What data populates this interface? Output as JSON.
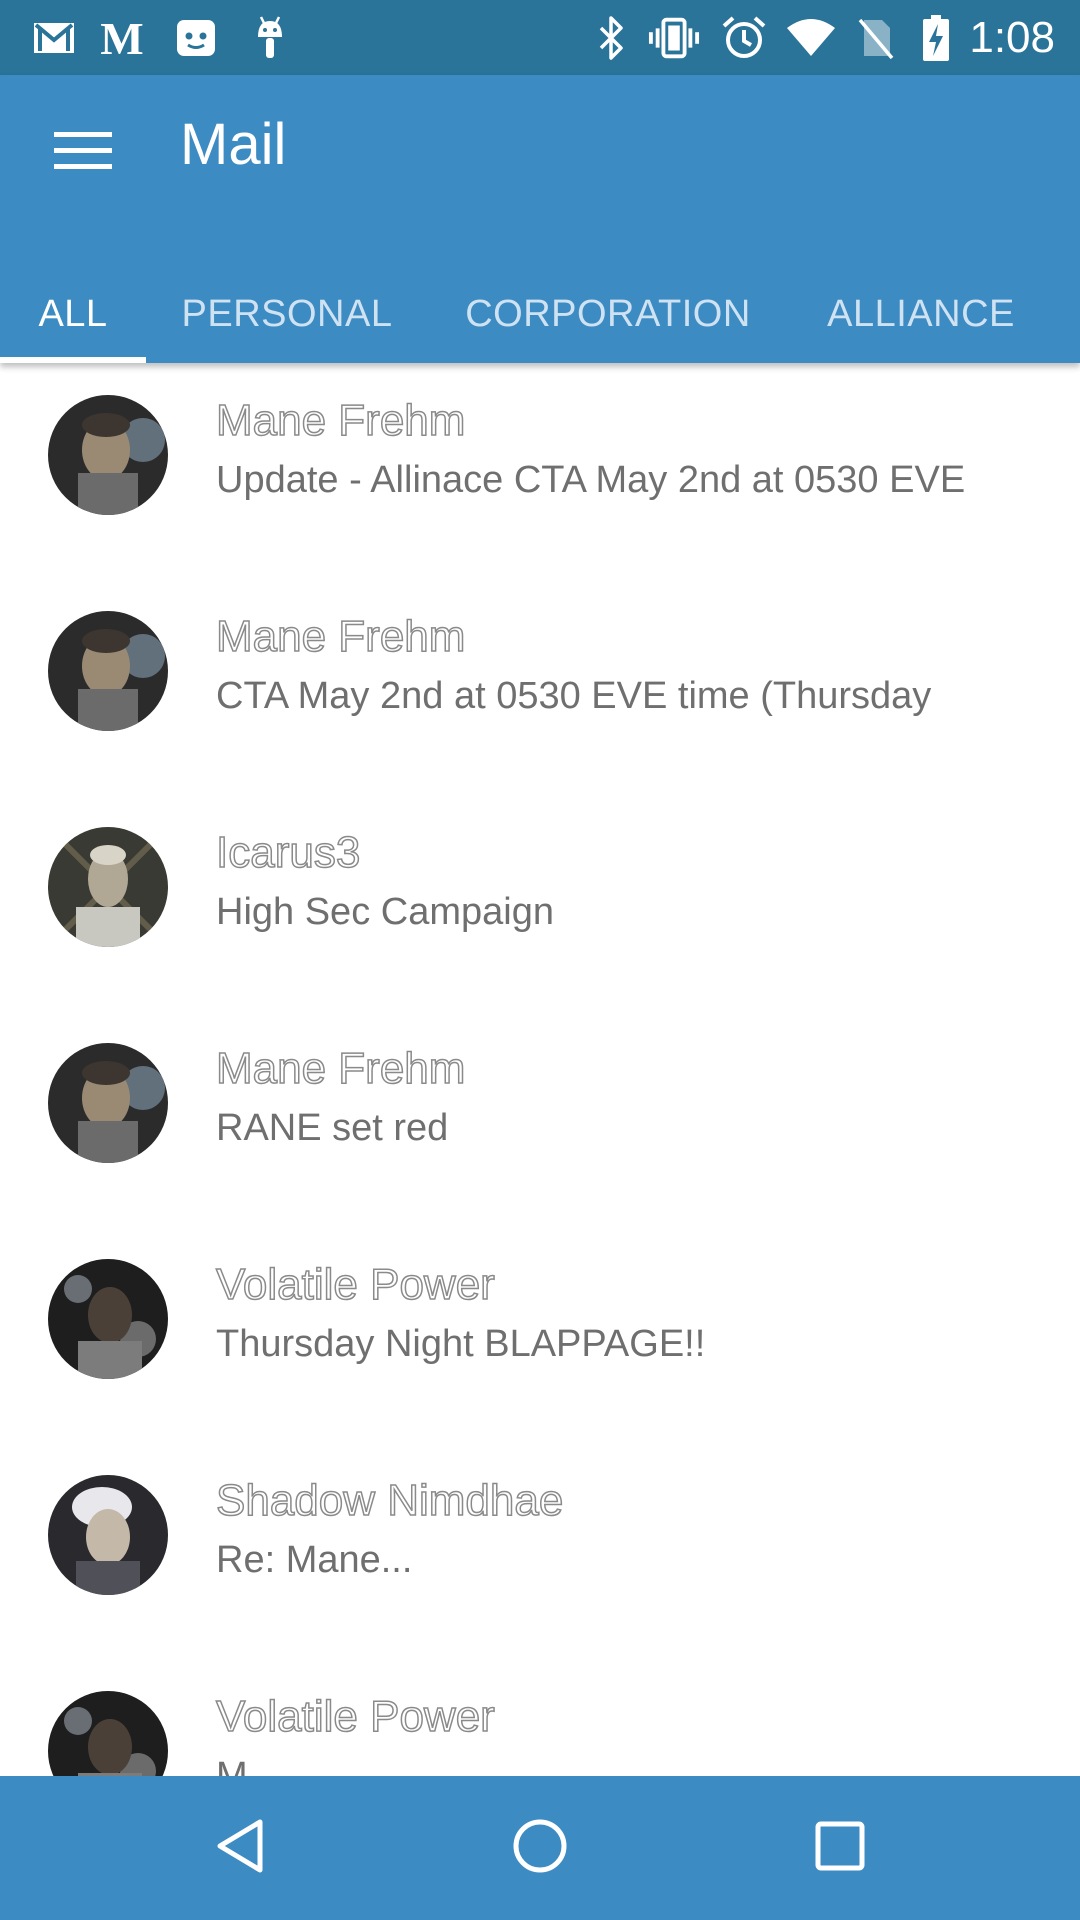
{
  "status_bar": {
    "time": "1:08",
    "left_icons": [
      "gmail-icon",
      "medium-icon",
      "app-face-icon",
      "android-icon"
    ],
    "right_icons": [
      "bluetooth-icon",
      "vibrate-icon",
      "alarm-icon",
      "wifi-icon",
      "no-sim-icon",
      "battery-charging-icon"
    ]
  },
  "app_bar": {
    "title": "Mail",
    "menu_icon": "hamburger-menu-icon"
  },
  "tabs": [
    {
      "label": "ALL",
      "active": true
    },
    {
      "label": "PERSONAL",
      "active": false
    },
    {
      "label": "CORPORATION",
      "active": false
    },
    {
      "label": "ALLIANCE",
      "active": false
    }
  ],
  "mails": [
    {
      "sender": "Mane Frehm",
      "subject": "Update - Allinace CTA May 2nd at 0530 EVE"
    },
    {
      "sender": "Mane Frehm",
      "subject": "CTA May 2nd at 0530 EVE time (Thursday"
    },
    {
      "sender": "Icarus3",
      "subject": "High Sec Campaign"
    },
    {
      "sender": "Mane Frehm",
      "subject": "RANE set red"
    },
    {
      "sender": "Volatile Power",
      "subject": "Thursday Night BLAPPAGE!!"
    },
    {
      "sender": "Shadow Nimdhae",
      "subject": "Re: Mane..."
    },
    {
      "sender": "Volatile Power",
      "subject": "M..."
    }
  ],
  "nav_bar": {
    "buttons": [
      "back-icon",
      "home-icon",
      "recents-icon"
    ]
  },
  "colors": {
    "status_bar": "#2a7399",
    "primary": "#3d8bc3",
    "tab_inactive": "#cfe2f1",
    "subject_text": "#6f6f6f"
  }
}
